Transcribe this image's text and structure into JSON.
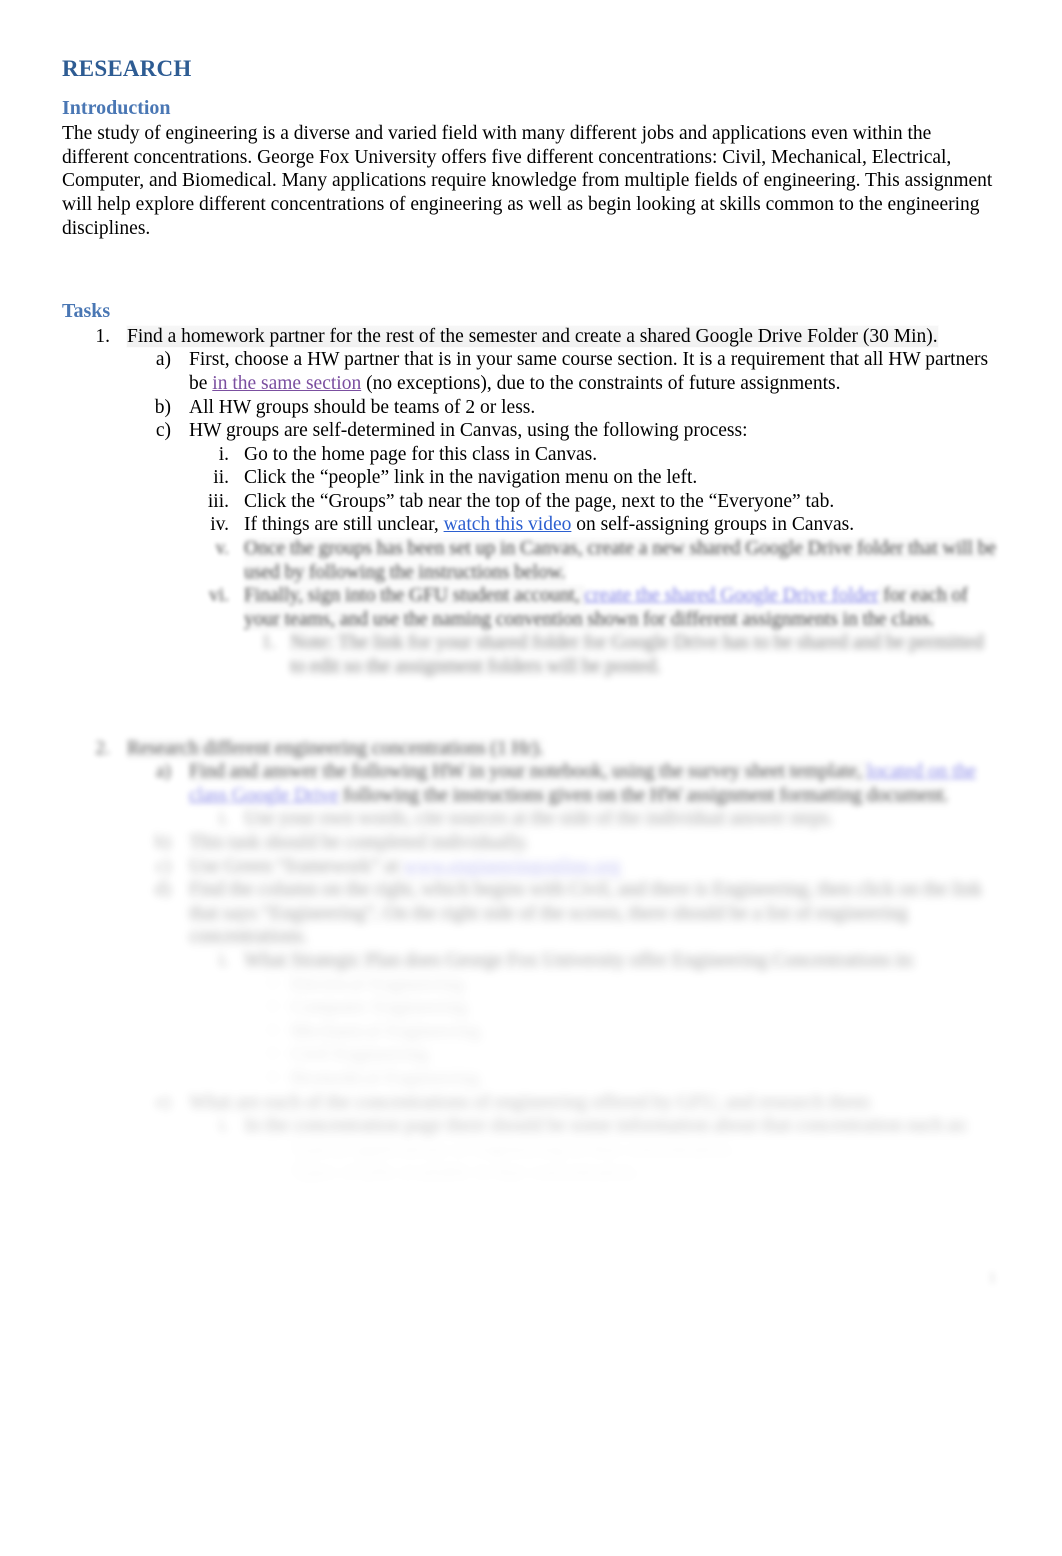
{
  "document": {
    "title": "RESEARCH",
    "page_number": "1"
  },
  "colors": {
    "heading1": "#2E5C93",
    "heading2": "#4A77B4",
    "link_purple": "#7B4FA0",
    "link_blue": "#2C5FD0",
    "link_indigo": "#4A4ADB",
    "body_text": "#000000",
    "page_background": "#FFFFFF",
    "highlight_gray": "rgba(0,0,0,0.05)"
  },
  "introduction": {
    "heading": "Introduction",
    "paragraph": "The study of engineering is a diverse and varied field with many different jobs and applications even within the different concentrations. George Fox University offers five different concentrations: Civil, Mechanical, Electrical, Computer, and Biomedical. Many applications require knowledge from multiple fields of engineering. This assignment will help explore different concentrations of engineering as well as begin looking at skills common to the engineering disciplines."
  },
  "tasks": {
    "heading": "Tasks",
    "items": [
      {
        "marker": "1.",
        "text": "Find a homework partner for the rest of the semester and create a shared Google Drive Folder (30 Min).",
        "highlighted": true,
        "children": [
          {
            "marker": "a)",
            "text_before_link": "First, choose a HW partner that is in your same course section. It is a requirement that all HW partners be ",
            "link_text": "in the same section",
            "link_style": "purple",
            "text_after_link": " (no exceptions), due to the constraints of future assignments."
          },
          {
            "marker": "b)",
            "text": "All HW groups should be teams of 2 or less."
          },
          {
            "marker": "c)",
            "text": "HW groups are self-determined in Canvas, using the following process:",
            "children": [
              {
                "marker": "i.",
                "text": "Go to the home page for this class in Canvas."
              },
              {
                "marker": "ii.",
                "text": "Click the “people” link in the navigation menu on the left."
              },
              {
                "marker": "iii.",
                "text": "Click the “Groups” tab near the top of the page, next to the “Everyone” tab."
              },
              {
                "marker": "iv.",
                "text_before_link": "If things are still unclear, ",
                "link_text": "watch this video",
                "link_style": "blue",
                "text_after_link": " on self-assigning groups in Canvas."
              },
              {
                "marker": "v.",
                "blurred": true,
                "blur_level": 1,
                "text": "Once the groups has been set up in Canvas, create a new shared Google Drive folder that will be used by following the instructions below."
              },
              {
                "marker": "vi.",
                "blurred": true,
                "blur_level": 1,
                "text_before_link": "Finally, sign into the GFU student account, ",
                "link_text": "create the shared Google Drive folder",
                "link_style": "indigo",
                "text_after_link": " for each of your teams, and use the naming convention shown for different assignments in the class."
              },
              {
                "marker": "1.",
                "blurred": true,
                "blur_level": 2,
                "text": "Note: The link for your shared folder for Google Drive has to be shared and be permitted to edit so the assignment folders will be posted."
              }
            ]
          }
        ]
      },
      {
        "marker": "2.",
        "blurred": true,
        "blur_level": 2,
        "text": "Research different engineering concentrations (1 Hr).",
        "children": [
          {
            "marker": "a)",
            "blurred": true,
            "blur_level": 2,
            "text_before_link": "Find and answer the following HW in your notebook, using the survey sheet template, ",
            "link_text": "located on the class Google Drive",
            "link_style": "indigo",
            "text_after_link": " following the instructions given on the HW assignment formatting document.",
            "children": [
              {
                "marker": "i.",
                "blurred": true,
                "blur_level": 3,
                "text": "Use your own words, cite sources at the side of the individual answer steps."
              }
            ]
          },
          {
            "marker": "b)",
            "blurred": true,
            "blur_level": 3,
            "text": "This task should be completed individually."
          },
          {
            "marker": "c)",
            "blurred": true,
            "blur_level": 3,
            "text_before_link": "Use Green “framework” at ",
            "link_text": "www.engineeringonline.org",
            "link_style": "indigo",
            "text_after_link": ""
          },
          {
            "marker": "d)",
            "blurred": true,
            "blur_level": 3,
            "text": "Find the column on the right, which begins with Civil, and there is Engineering, then click on the link that says “Engineering”. On the right side of the screen, there should be a list of engineering concentrations.",
            "children": [
              {
                "marker": "i.",
                "blurred": true,
                "blur_level": 3,
                "text": "What Strategic Plan does George Fox University offer Engineering Concentrations in:",
                "children": [
                  {
                    "marker": "•",
                    "blurred": true,
                    "blur_level": 4,
                    "text": "Electrical Engineering"
                  },
                  {
                    "marker": "•",
                    "blurred": true,
                    "blur_level": 4,
                    "text": "Computer Engineering"
                  },
                  {
                    "marker": "•",
                    "blurred": true,
                    "blur_level": 4,
                    "text": "Mechanical Engineering"
                  },
                  {
                    "marker": "•",
                    "blurred": true,
                    "blur_level": 4,
                    "text": "Civil Engineering"
                  },
                  {
                    "marker": "•",
                    "blurred": true,
                    "blur_level": 4,
                    "text": "Biomedical Engineering"
                  }
                ]
              }
            ]
          },
          {
            "marker": "e)",
            "blurred": true,
            "blur_level": 4,
            "text": "What are each of the concentrations of engineering offered by GFU, and research them:",
            "children": [
              {
                "marker": "i.",
                "blurred": true,
                "blur_level": 4,
                "text": "In the concentration page there should be some information about that concentration such as:",
                "children": [
                  {
                    "marker": "•",
                    "blurred": true,
                    "blur_level": 5,
                    "text": "Typical applications of engineering in that concentration."
                  },
                  {
                    "marker": "•",
                    "blurred": true,
                    "blur_level": 5,
                    "text": "Types of jobs available in that concentration."
                  }
                ]
              }
            ]
          }
        ]
      }
    ]
  }
}
